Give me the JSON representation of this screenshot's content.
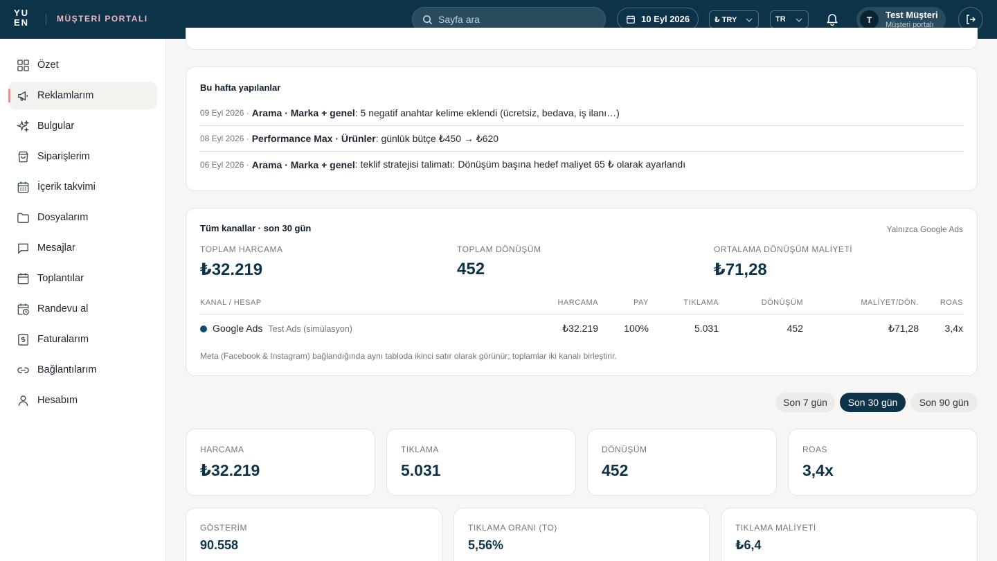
{
  "header": {
    "logo": "YU EN",
    "portal_title": "MÜŞTERİ PORTALI",
    "search_placeholder": "Sayfa ara",
    "date": "10 Eyl 2026",
    "currency": "₺ TRY",
    "language": "TR",
    "user_initial": "T",
    "user_name": "Test Müşteri",
    "user_sub": "Müşteri portalı"
  },
  "sidebar": {
    "items": [
      {
        "label": "Özet",
        "icon": "grid-icon"
      },
      {
        "label": "Reklamlarım",
        "icon": "megaphone-icon",
        "active": true
      },
      {
        "label": "Bulgular",
        "icon": "sparkle-icon"
      },
      {
        "label": "Siparişlerim",
        "icon": "shopping-bag-icon"
      },
      {
        "label": "İçerik takvimi",
        "icon": "calendar-grid-icon"
      },
      {
        "label": "Dosyalarım",
        "icon": "folder-icon"
      },
      {
        "label": "Mesajlar",
        "icon": "message-icon"
      },
      {
        "label": "Toplantılar",
        "icon": "calendar-icon"
      },
      {
        "label": "Randevu al",
        "icon": "calendar-clock-icon"
      },
      {
        "label": "Faturalarım",
        "icon": "invoice-icon"
      },
      {
        "label": "Bağlantılarım",
        "icon": "link-icon"
      },
      {
        "label": "Hesabım",
        "icon": "user-icon"
      }
    ]
  },
  "week": {
    "title": "Bu hafta yapılanlar",
    "rows": [
      {
        "date": "09 Eyl 2026 ·",
        "bold": "Arama · Marka + genel",
        "text": ": 5 negatif anahtar kelime eklendi (ücretsiz, bedava, iş ilanı…)"
      },
      {
        "date": "08 Eyl 2026 ·",
        "bold": "Performance Max · Ürünler",
        "text": ": günlük bütçe ₺450 → ₺620"
      },
      {
        "date": "06 Eyl 2026 ·",
        "bold": "Arama · Marka + genel",
        "text": ": teklif stratejisi talimatı: Dönüşüm başına hedef maliyet 65 ₺ olarak ayarlandı"
      }
    ]
  },
  "channels": {
    "title": "Tüm kanallar · son 30 gün",
    "note_right": "Yalnızca Google Ads",
    "kpis": [
      {
        "label": "TOPLAM HARCAMA",
        "value": "₺32.219"
      },
      {
        "label": "TOPLAM DÖNÜŞÜM",
        "value": "452"
      },
      {
        "label": "ORTALAMA DÖNÜŞÜM MALİYETİ",
        "value": "₺71,28"
      }
    ],
    "columns": [
      "KANAL / HESAP",
      "HARCAMA",
      "PAY",
      "TIKLAMA",
      "DÖNÜŞÜM",
      "MALİYET/DÖN.",
      "ROAS"
    ],
    "row": {
      "channel": "Google Ads",
      "account": "Test Ads (simülasyon)",
      "spend": "₺32.219",
      "share": "100%",
      "clicks": "5.031",
      "conversions": "452",
      "cost_per_conv": "₺71,28",
      "roas": "3,4x",
      "dot_color": "#0f4a6a"
    },
    "footnote": "Meta (Facebook & Instagram) bağlandığında aynı tabloda ikinci satır olarak görünür; toplamlar iki kanalı birleştirir."
  },
  "range": {
    "options": [
      "Son 7 gün",
      "Son 30 gün",
      "Son 90 gün"
    ],
    "selected": "Son 30 gün"
  },
  "stats_row1": [
    {
      "label": "HARCAMA",
      "value": "₺32.219"
    },
    {
      "label": "TIKLAMA",
      "value": "5.031"
    },
    {
      "label": "DÖNÜŞÜM",
      "value": "452"
    },
    {
      "label": "ROAS",
      "value": "3,4x"
    }
  ],
  "stats_row2": [
    {
      "label": "GÖSTERİM",
      "value": "90.558"
    },
    {
      "label": "TIKLAMA ORANI (TO)",
      "value": "5,56%"
    },
    {
      "label": "TIKLAMA MALİYETİ",
      "value": "₺6,4"
    }
  ],
  "colors": {
    "brand_dark": "#0d3349",
    "accent_pink": "#e98f9b"
  }
}
